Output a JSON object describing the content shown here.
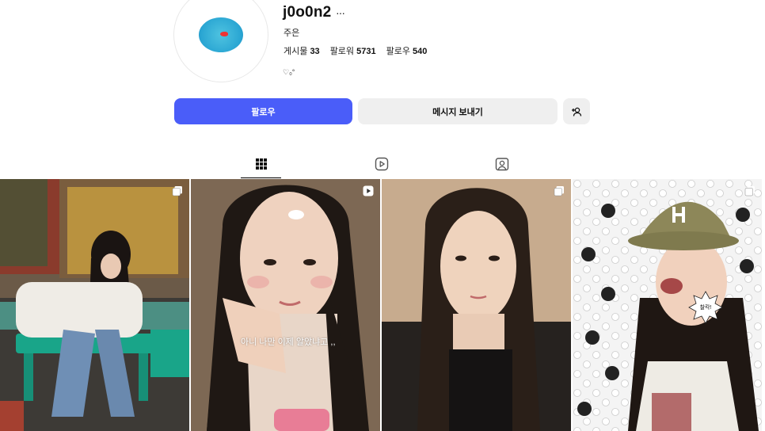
{
  "profile": {
    "username": "j0o0n2",
    "full_name": "주은",
    "bio": "♡₀°"
  },
  "stats": {
    "posts_label": "게시물",
    "posts_count": "33",
    "followers_label": "팔로워",
    "followers_count": "5731",
    "following_label": "팔로우",
    "following_count": "540"
  },
  "actions": {
    "follow_label": "팔로우",
    "message_label": "메시지 보내기"
  },
  "tabs": [
    {
      "name": "posts",
      "icon": "grid-icon",
      "active": true
    },
    {
      "name": "reels",
      "icon": "reels-icon",
      "active": false
    },
    {
      "name": "tagged",
      "icon": "tagged-icon",
      "active": false
    }
  ],
  "posts": [
    {
      "type": "carousel",
      "badge_icon": "carousel-icon"
    },
    {
      "type": "reel",
      "badge_icon": "reel-icon",
      "caption": "아니 나만 이제 알았냐고 ,,"
    },
    {
      "type": "carousel",
      "badge_icon": "carousel-icon"
    },
    {
      "type": "carousel",
      "badge_icon": "carousel-icon",
      "sticker_text": "찰칵!"
    }
  ],
  "colors": {
    "follow_button": "#4a5df9",
    "secondary_button": "#efefef"
  }
}
